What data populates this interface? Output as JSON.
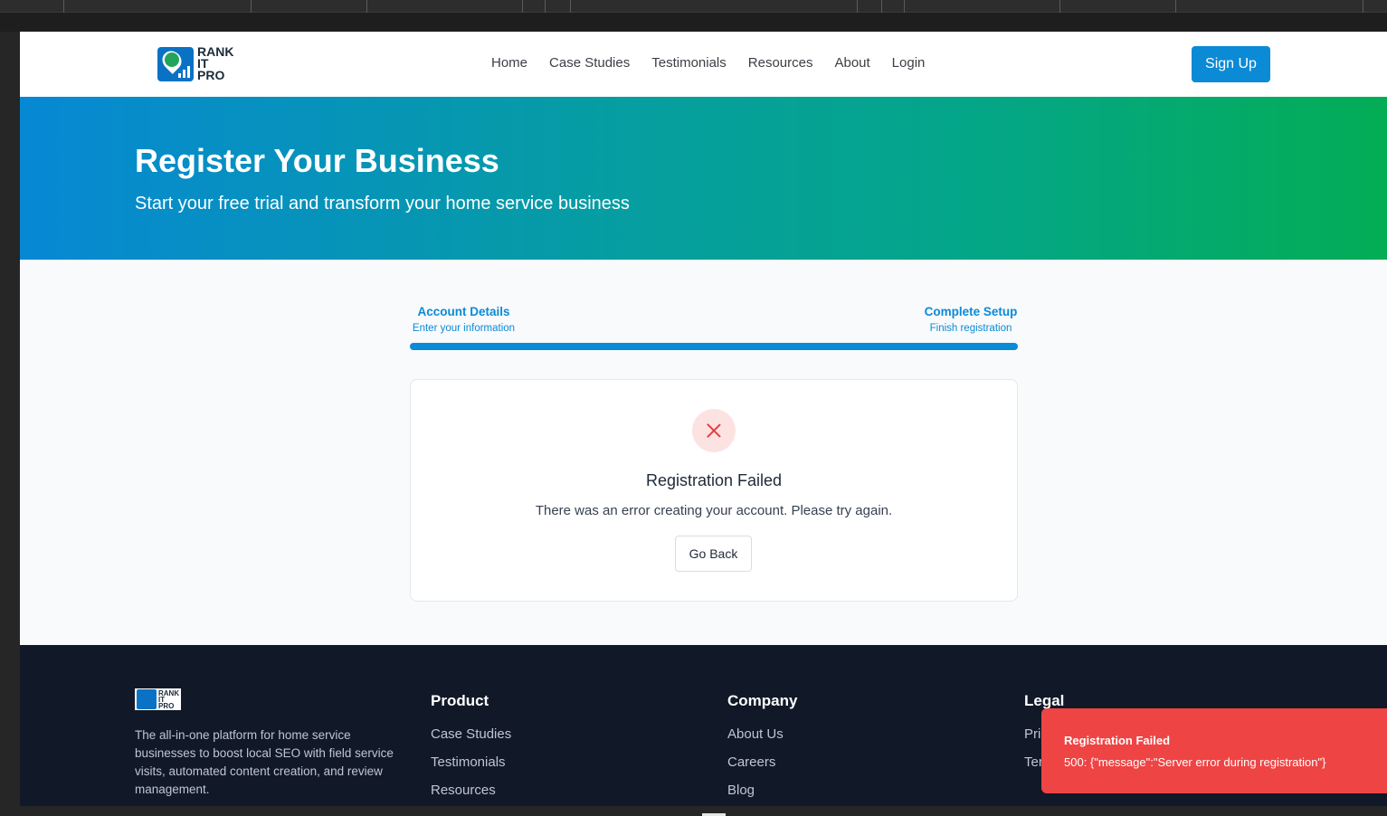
{
  "header": {
    "logo_lines": [
      "RANK",
      "IT",
      "PRO"
    ],
    "nav": [
      "Home",
      "Case Studies",
      "Testimonials",
      "Resources",
      "About",
      "Login"
    ],
    "signup_label": "Sign Up"
  },
  "hero": {
    "title": "Register Your Business",
    "subtitle": "Start your free trial and transform your home service business"
  },
  "steps": {
    "left": {
      "title": "Account Details",
      "subtitle": "Enter your information"
    },
    "right": {
      "title": "Complete Setup",
      "subtitle": "Finish registration"
    },
    "progress_fraction": 1.0
  },
  "card": {
    "title": "Registration Failed",
    "message": "There was an error creating your account. Please try again.",
    "button_label": "Go Back"
  },
  "footer": {
    "description": "The all-in-one platform for home service businesses to boost local SEO with field service visits, automated content creation, and review management.",
    "product": {
      "heading": "Product",
      "links": [
        "Case Studies",
        "Testimonials",
        "Resources"
      ]
    },
    "company": {
      "heading": "Company",
      "links": [
        "About Us",
        "Careers",
        "Blog"
      ]
    },
    "legal": {
      "heading": "Legal",
      "links": [
        "Pri",
        "Ter"
      ]
    }
  },
  "toast": {
    "title": "Registration Failed",
    "message": "500: {\"message\":\"Server error during registration\"}"
  },
  "colors": {
    "accent": "#0b8ad6",
    "toast": "#ef4444",
    "footer_bg": "#111827"
  }
}
